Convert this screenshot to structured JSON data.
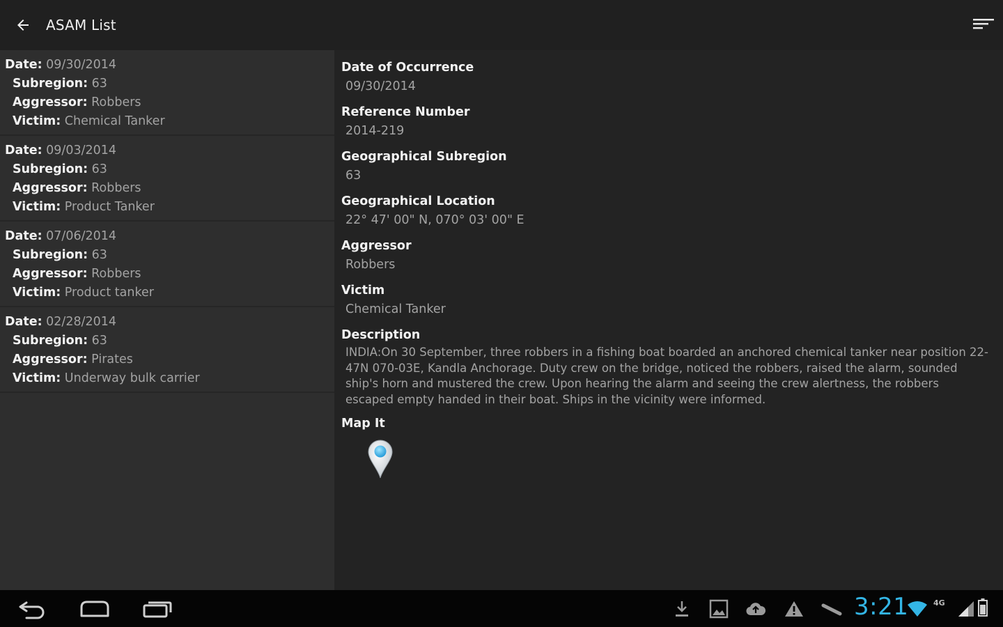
{
  "header": {
    "title": "ASAM List",
    "back_icon": "arrow-back-icon",
    "overflow_icon": "sort-icon"
  },
  "list": {
    "labels": {
      "date": "Date:",
      "subregion": "Subregion:",
      "aggressor": "Aggressor:",
      "victim": "Victim:"
    },
    "items": [
      {
        "date": "09/30/2014",
        "subregion": "63",
        "aggressor": "Robbers",
        "victim": "Chemical Tanker"
      },
      {
        "date": "09/03/2014",
        "subregion": "63",
        "aggressor": "Robbers",
        "victim": "Product Tanker"
      },
      {
        "date": "07/06/2014",
        "subregion": "63",
        "aggressor": "Robbers",
        "victim": "Product tanker"
      },
      {
        "date": "02/28/2014",
        "subregion": "63",
        "aggressor": "Pirates",
        "victim": "Underway bulk carrier"
      }
    ]
  },
  "detail": {
    "fields": [
      {
        "label": "Date of Occurrence",
        "value": "09/30/2014"
      },
      {
        "label": "Reference Number",
        "value": "2014-219"
      },
      {
        "label": "Geographical Subregion",
        "value": "63"
      },
      {
        "label": "Geographical Location",
        "value": "22° 47' 00\" N, 070° 03' 00\" E"
      },
      {
        "label": "Aggressor",
        "value": "Robbers"
      },
      {
        "label": "Victim",
        "value": "Chemical Tanker"
      }
    ],
    "description_label": "Description",
    "description": "INDIA:On 30 September, three robbers in a fishing boat boarded an anchored chemical tanker near position 22-47N 070-03E, Kandla Anchorage. Duty crew on the bridge, noticed the robbers, raised the alarm, sounded ship's horn and mustered the crew. Upon hearing the alarm and seeing the crew alertness, the robbers escaped empty handed in their boat. Ships in the vicinity were informed.",
    "map_label": "Map It",
    "map_icon": "map-pin-icon"
  },
  "system_bar": {
    "time": "3:21",
    "network": "4G",
    "accent_color": "#33b5e5"
  }
}
